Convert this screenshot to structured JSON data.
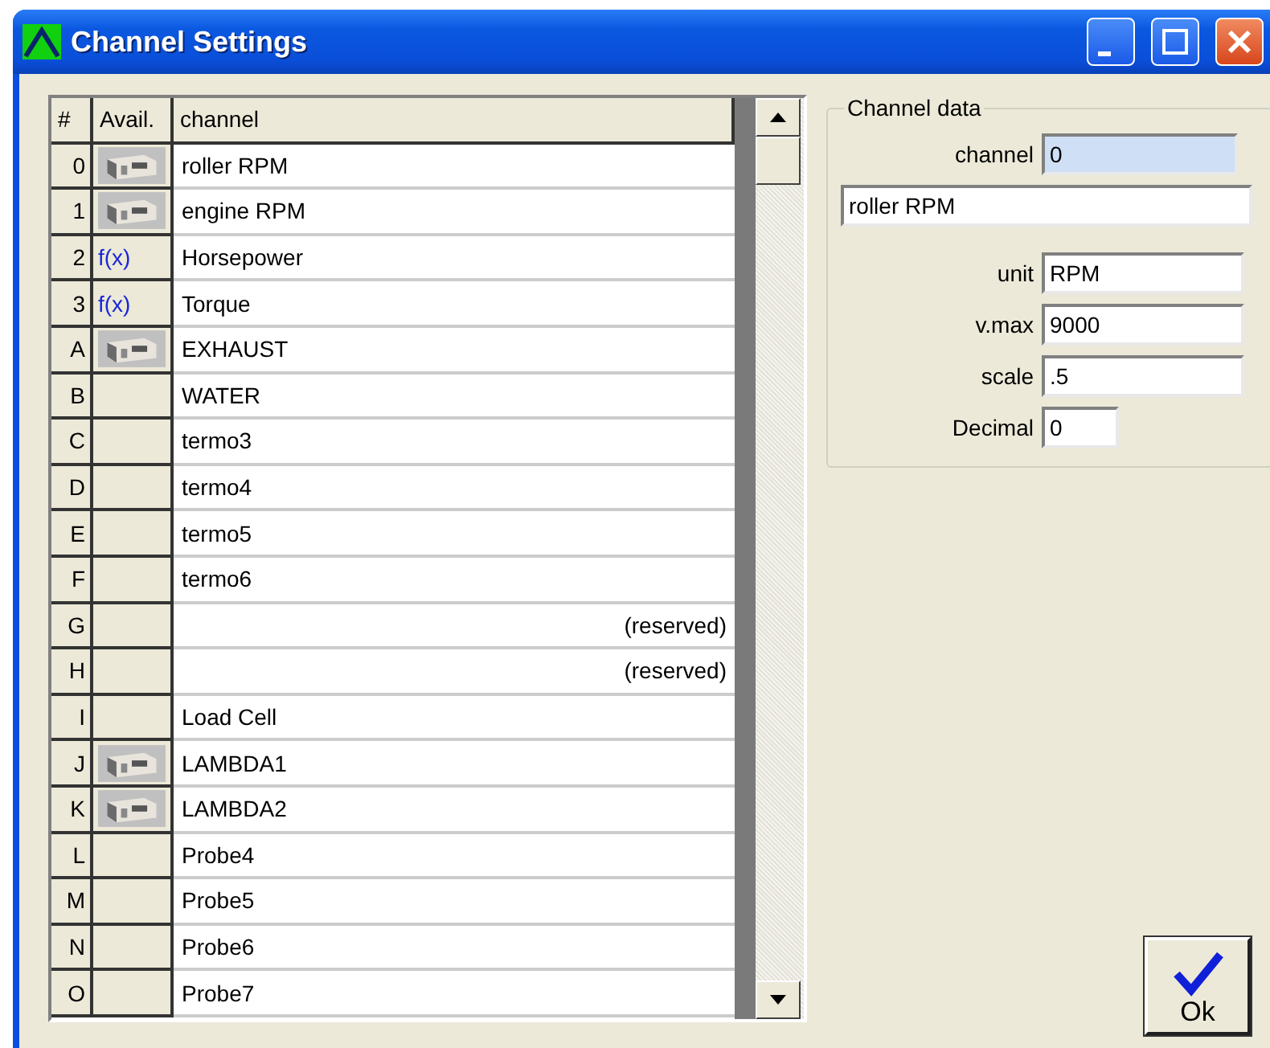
{
  "window": {
    "title": "Channel Settings",
    "controls": [
      {
        "kind": "minimize"
      },
      {
        "kind": "maximize"
      },
      {
        "kind": "close"
      }
    ]
  },
  "table": {
    "columns": [
      "#",
      "Avail.",
      "channel"
    ],
    "rows": [
      {
        "index": "0",
        "avail": {
          "kind": "device"
        },
        "channel": "roller RPM",
        "kind": "normal"
      },
      {
        "index": "1",
        "avail": {
          "kind": "device"
        },
        "channel": "engine RPM",
        "kind": "normal"
      },
      {
        "index": "2",
        "avail": {
          "kind": "formula",
          "text": "f(x)"
        },
        "channel": "Horsepower",
        "kind": "normal"
      },
      {
        "index": "3",
        "avail": {
          "kind": "formula",
          "text": "f(x)"
        },
        "channel": "Torque",
        "kind": "normal"
      },
      {
        "index": "A",
        "avail": {
          "kind": "device"
        },
        "channel": "EXHAUST",
        "kind": "normal"
      },
      {
        "index": "B",
        "avail": {
          "kind": "none"
        },
        "channel": "WATER",
        "kind": "normal"
      },
      {
        "index": "C",
        "avail": {
          "kind": "none"
        },
        "channel": "termo3",
        "kind": "normal"
      },
      {
        "index": "D",
        "avail": {
          "kind": "none"
        },
        "channel": "termo4",
        "kind": "normal"
      },
      {
        "index": "E",
        "avail": {
          "kind": "none"
        },
        "channel": "termo5",
        "kind": "normal"
      },
      {
        "index": "F",
        "avail": {
          "kind": "none"
        },
        "channel": "termo6",
        "kind": "normal"
      },
      {
        "index": "G",
        "avail": {
          "kind": "none"
        },
        "channel": "(reserved)",
        "kind": "reserved"
      },
      {
        "index": "H",
        "avail": {
          "kind": "none"
        },
        "channel": "(reserved)",
        "kind": "reserved"
      },
      {
        "index": "I",
        "avail": {
          "kind": "none"
        },
        "channel": "Load Cell",
        "kind": "normal"
      },
      {
        "index": "J",
        "avail": {
          "kind": "device"
        },
        "channel": "LAMBDA1",
        "kind": "normal"
      },
      {
        "index": "K",
        "avail": {
          "kind": "device"
        },
        "channel": "LAMBDA2",
        "kind": "normal"
      },
      {
        "index": "L",
        "avail": {
          "kind": "none"
        },
        "channel": "Probe4",
        "kind": "normal"
      },
      {
        "index": "M",
        "avail": {
          "kind": "none"
        },
        "channel": "Probe5",
        "kind": "normal"
      },
      {
        "index": "N",
        "avail": {
          "kind": "none"
        },
        "channel": "Probe6",
        "kind": "normal"
      },
      {
        "index": "O",
        "avail": {
          "kind": "none"
        },
        "channel": "Probe7",
        "kind": "normal"
      }
    ]
  },
  "channel_data": {
    "title": "Channel data",
    "channel": {
      "label": "channel",
      "value": "0",
      "disabled": true
    },
    "name": {
      "value": "roller RPM"
    },
    "fields": [
      {
        "label": "unit",
        "value": "RPM",
        "kind": "wide"
      },
      {
        "label": "v.max",
        "value": "9000",
        "kind": "wide"
      },
      {
        "label": "scale",
        "value": ".5",
        "kind": "wide"
      },
      {
        "label": "Decimal",
        "value": "0",
        "kind": "narrow"
      }
    ]
  },
  "ok_button": {
    "label": "Ok"
  }
}
